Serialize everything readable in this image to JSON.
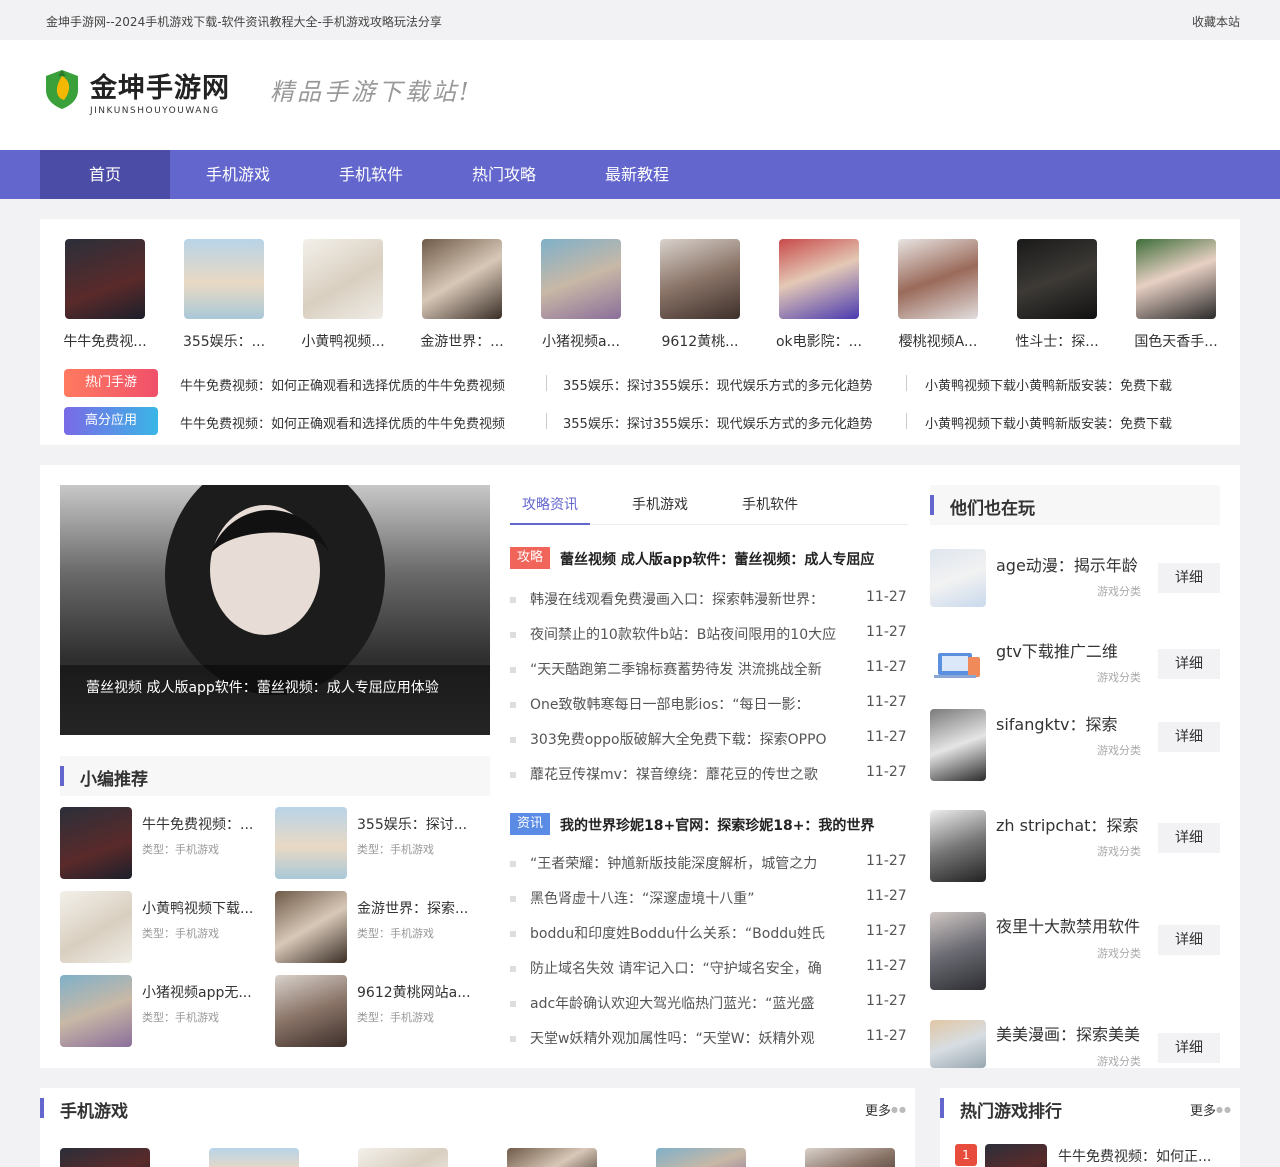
{
  "topbar": {
    "title": "金坤手游网--2024手机游戏下载-软件资讯教程大全-手机游戏攻略玩法分享",
    "favorite": "收藏本站"
  },
  "header": {
    "logo_name": "金坤手游网",
    "logo_pinyin": "JINKUNSHOUYOUWANG",
    "slogan": "精品手游下载站!"
  },
  "nav": [
    "首页",
    "手机游戏",
    "手机软件",
    "热门攻略",
    "最新教程"
  ],
  "top_games": [
    "牛牛免费视...",
    "355娱乐：...",
    "小黄鸭视频...",
    "金游世界：...",
    "小猪视频a...",
    "9612黄桃...",
    "ok电影院：...",
    "樱桃视频A...",
    "性斗士：探...",
    "国色天香手..."
  ],
  "tag_rows": [
    {
      "label": "热门手游",
      "color": "#f0645a",
      "links": [
        "牛牛免费视频：如何正确观看和选择优质的牛牛免费视频",
        "355娱乐：探讨355娱乐：现代娱乐方式的多元化趋势",
        "小黄鸭视频下载小黄鸭新版安装：免费下载"
      ]
    },
    {
      "label": "高分应用",
      "color": "#5a8ce6",
      "links": [
        "牛牛免费视频：如何正确观看和选择优质的牛牛免费视频",
        "355娱乐：探讨355娱乐：现代娱乐方式的多元化趋势",
        "小黄鸭视频下载小黄鸭新版安装：免费下载"
      ]
    }
  ],
  "featured": {
    "caption": "蕾丝视频 成人版app软件：蕾丝视频：成人专屈应用体验"
  },
  "editor_section": {
    "title": "小编推荐"
  },
  "editor_items": [
    {
      "title": "牛牛免费视频：...",
      "type": "类型：手机游戏"
    },
    {
      "title": "355娱乐：探讨...",
      "type": "类型：手机游戏"
    },
    {
      "title": "小黄鸭视频下载...",
      "type": "类型：手机游戏"
    },
    {
      "title": "金游世界：探索...",
      "type": "类型：手机游戏"
    },
    {
      "title": "小猪视频app无...",
      "type": "类型：手机游戏"
    },
    {
      "title": "9612黄桃网站a...",
      "type": "类型：手机游戏"
    }
  ],
  "tabs": [
    "攻略资讯",
    "手机游戏",
    "手机软件"
  ],
  "news_groups": [
    {
      "badge": "攻略",
      "badge_color": "#f0645a",
      "headline": "蕾丝视频 成人版app软件：蕾丝视频：成人专屈应",
      "items": [
        {
          "t": "韩漫在线观看免费漫画入口：探索韩漫新世界：",
          "d": "11-27"
        },
        {
          "t": "夜间禁止的10款软件b站：B站夜间限用的10大应",
          "d": "11-27"
        },
        {
          "t": "“天天酷跑第二季锦标赛蓄势待发 洪流挑战全新",
          "d": "11-27"
        },
        {
          "t": "One致敬韩寒每日一部电影ios：“每日一影：",
          "d": "11-27"
        },
        {
          "t": "303免费oppo版破解大全免费下载：探索OPPO",
          "d": "11-27"
        },
        {
          "t": "蘼花豆传禖mv：禖音缭绕：蘼花豆的传世之歌",
          "d": "11-27"
        }
      ]
    },
    {
      "badge": "资讯",
      "badge_color": "#5a8ce6",
      "headline": "我的世界珍妮18+官网：探索珍妮18+：我的世界",
      "items": [
        {
          "t": "“王者荣耀：钟馗新版技能深度解析，城管之力",
          "d": "11-27"
        },
        {
          "t": "黑色肾虚十八连：“深邃虚境十八重”",
          "d": "11-27"
        },
        {
          "t": "boddu和印度姓Boddu什么关系：“Boddu姓氏",
          "d": "11-27"
        },
        {
          "t": "防止域名失效 请牢记入口：“守护域名安全，确",
          "d": "11-27"
        },
        {
          "t": "adc年龄确认欢迎大驾光临热门蓝光：“蓝光盛",
          "d": "11-27"
        },
        {
          "t": "天堂w妖精外观加属性吗：“天堂W：妖精外观",
          "d": "11-27"
        }
      ]
    }
  ],
  "players_section": {
    "title": "他们也在玩"
  },
  "players": [
    {
      "name": "age动漫：揭示年龄",
      "cat": "游戏分类",
      "btn": "详细"
    },
    {
      "name": "gtv下载推广二维",
      "cat": "游戏分类",
      "btn": "详细"
    },
    {
      "name": "sifangktv：探索",
      "cat": "游戏分类",
      "btn": "详细"
    },
    {
      "name": "zh stripchat：探索",
      "cat": "游戏分类",
      "btn": "详细"
    },
    {
      "name": "夜里十大款禁用软件",
      "cat": "游戏分类",
      "btn": "详细"
    },
    {
      "name": "美美漫画：探索美美",
      "cat": "游戏分类",
      "btn": "详细"
    }
  ],
  "games_section": {
    "title": "手机游戏",
    "more": "更多"
  },
  "ranking_section": {
    "title": "热门游戏排行",
    "more": "更多"
  },
  "ranking": [
    {
      "rank": "1",
      "title": "牛牛免费视频：如何正..."
    }
  ],
  "colors": {
    "accent": "#6366cc",
    "nav_active": "#4a4ca5",
    "hot": "#f0645a",
    "app": "#5a8ce6"
  }
}
